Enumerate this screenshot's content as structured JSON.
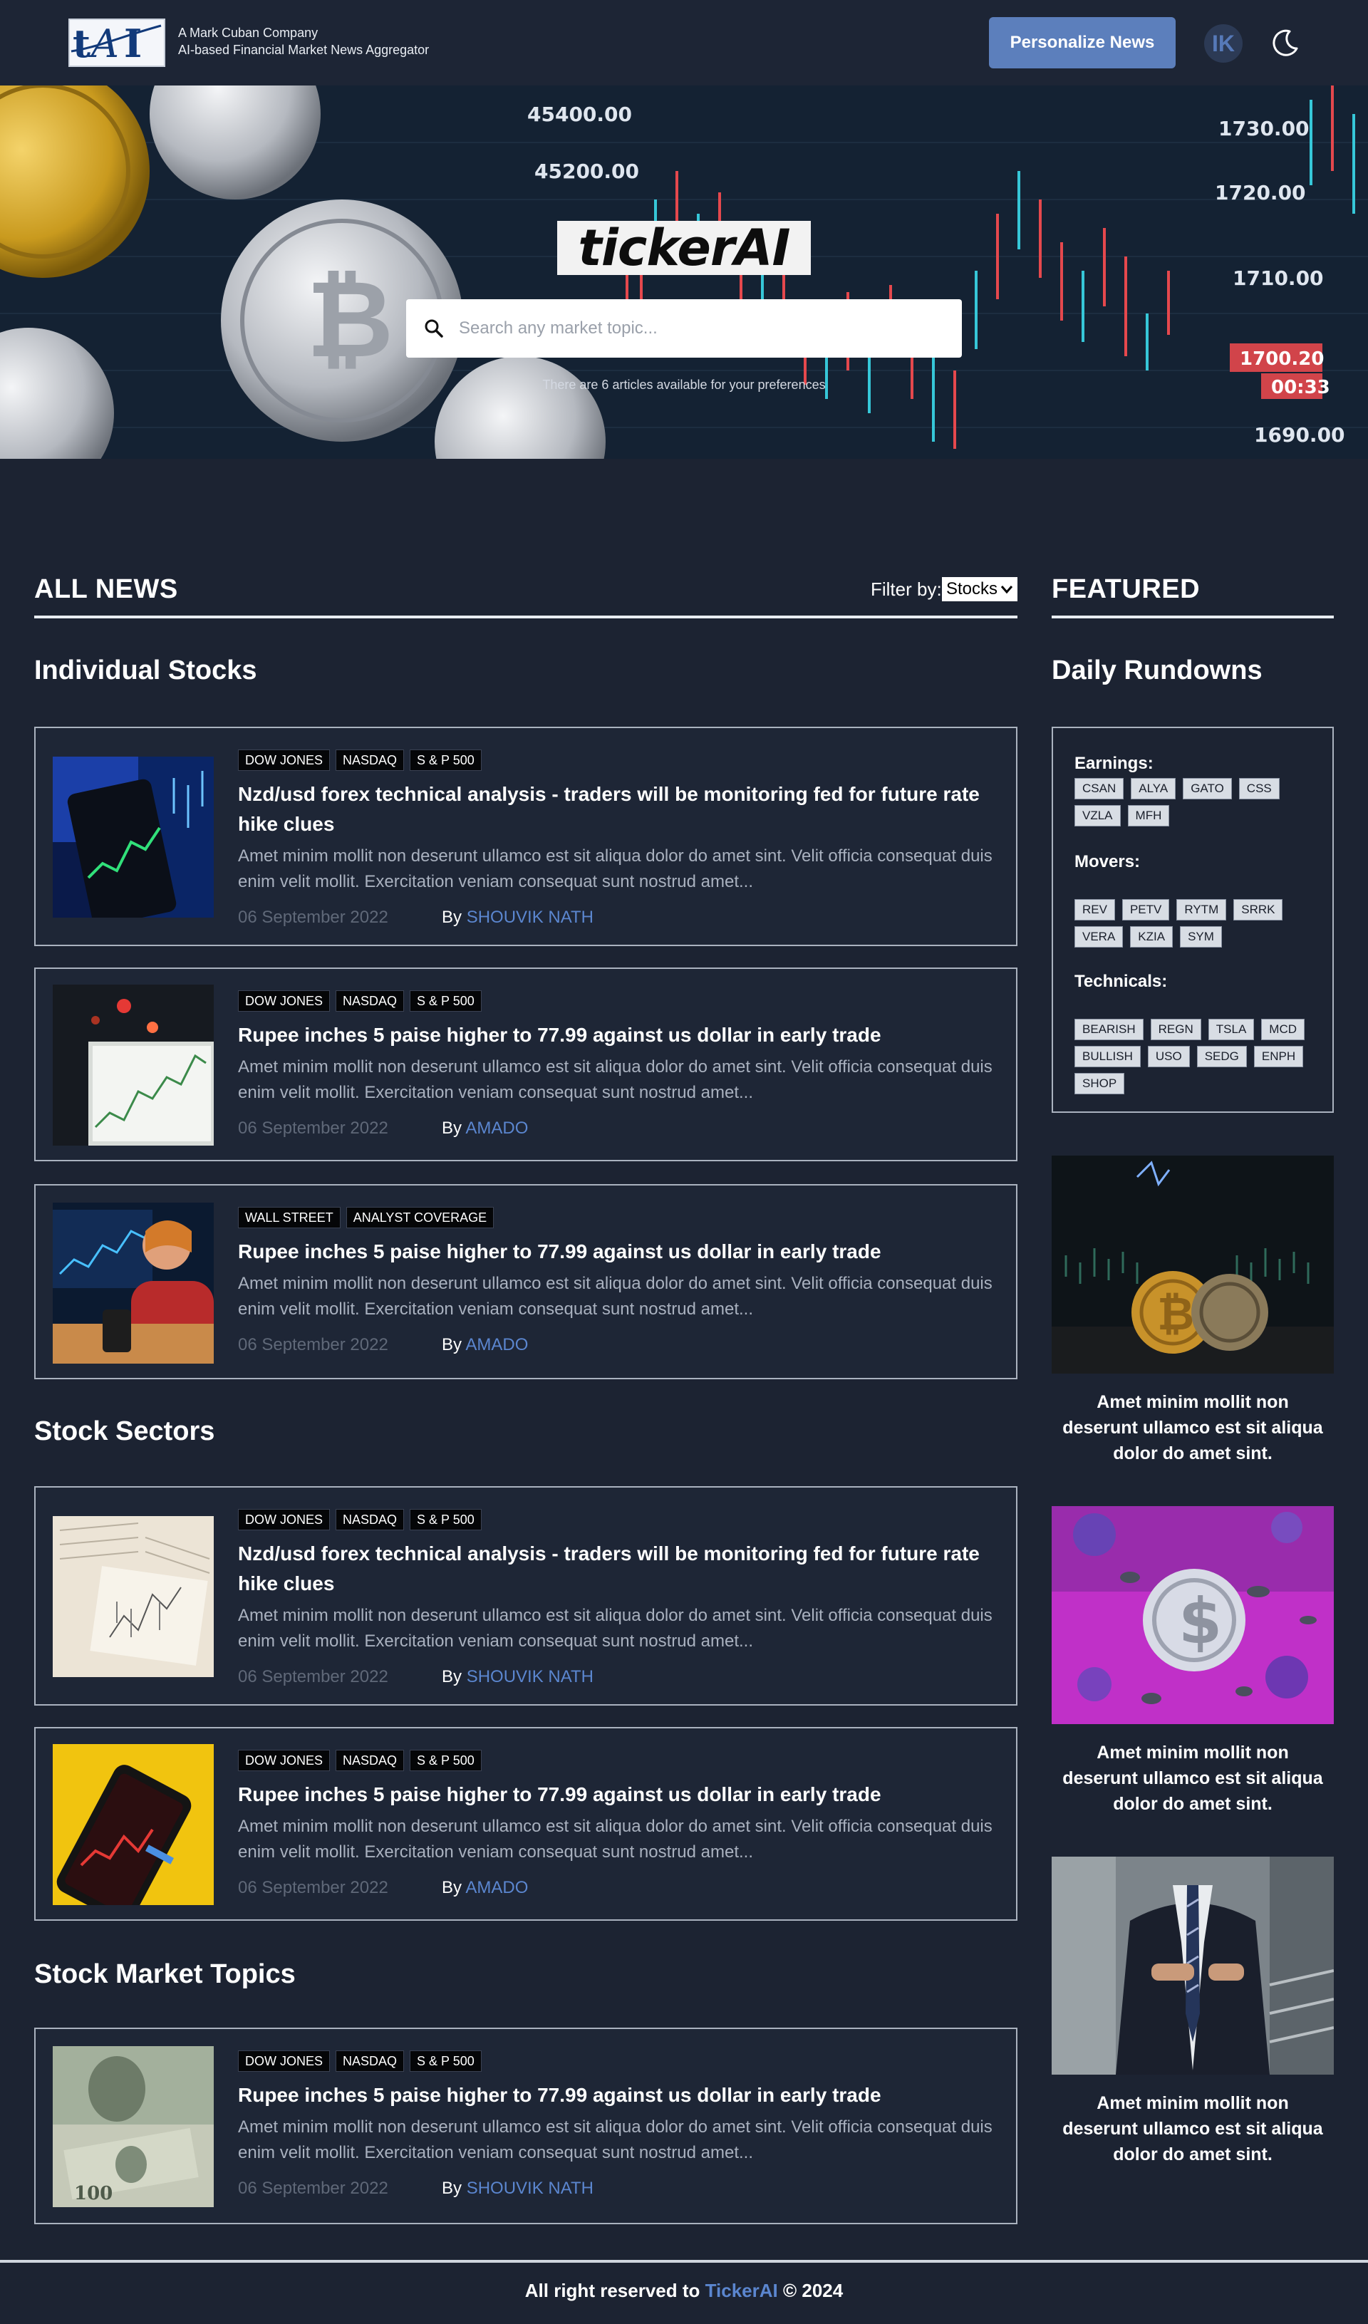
{
  "header": {
    "tagline_company": "A Mark Cuban Company",
    "tagline_desc": "AI-based Financial Market News Aggregator",
    "personalize_label": "Personalize News",
    "avatar_initials": "IK"
  },
  "hero": {
    "brand": "tickerAI",
    "search_placeholder": "Search any market topic...",
    "note": "There are 6 articles available for your preferences"
  },
  "main": {
    "all_news_label": "ALL NEWS",
    "filter_label": "Filter by:",
    "filter_value": "Stocks",
    "featured_label": "FEATURED",
    "sections": [
      {
        "title": "Individual Stocks"
      },
      {
        "title": "Stock Sectors"
      },
      {
        "title": "Stock Market Topics"
      }
    ],
    "articles": [
      {
        "tags": [
          "DOW JONES",
          "NASDAQ",
          "S & P 500"
        ],
        "title": "Nzd/usd forex technical analysis - traders will be monitoring fed for future rate hike clues",
        "excerpt": "Amet minim mollit non deserunt ullamco est sit aliqua dolor do amet sint. Velit officia consequat duis enim velit mollit. Exercitation veniam consequat sunt nostrud amet...",
        "date": "06 September 2022",
        "by": "By",
        "author": "SHOUVIK NATH"
      },
      {
        "tags": [
          "DOW JONES",
          "NASDAQ",
          "S & P 500"
        ],
        "title": "Rupee inches 5 paise higher to 77.99 against us dollar in early trade",
        "excerpt": "Amet minim mollit non deserunt ullamco est sit aliqua dolor do amet sint. Velit officia consequat duis enim velit mollit. Exercitation veniam consequat sunt nostrud amet...",
        "date": "06 September 2022",
        "by": "By",
        "author": "AMADO"
      },
      {
        "tags": [
          "WALL STREET",
          "ANALYST COVERAGE"
        ],
        "title": "Rupee inches 5 paise higher to 77.99 against us dollar in early trade",
        "excerpt": "Amet minim mollit non deserunt ullamco est sit aliqua dolor do amet sint. Velit officia consequat duis enim velit mollit. Exercitation veniam consequat sunt nostrud amet...",
        "date": "06 September 2022",
        "by": "By",
        "author": "AMADO"
      },
      {
        "tags": [
          "DOW JONES",
          "NASDAQ",
          "S & P 500"
        ],
        "title": "Nzd/usd forex technical analysis - traders will be monitoring fed for future rate hike clues",
        "excerpt": "Amet minim mollit non deserunt ullamco est sit aliqua dolor do amet sint. Velit officia consequat duis enim velit mollit. Exercitation veniam consequat sunt nostrud amet...",
        "date": "06 September 2022",
        "by": "By",
        "author": "SHOUVIK NATH"
      },
      {
        "tags": [
          "DOW JONES",
          "NASDAQ",
          "S & P 500"
        ],
        "title": "Rupee inches 5 paise higher to 77.99 against us dollar in early trade",
        "excerpt": "Amet minim mollit non deserunt ullamco est sit aliqua dolor do amet sint. Velit officia consequat duis enim velit mollit. Exercitation veniam consequat sunt nostrud amet...",
        "date": "06 September 2022",
        "by": "By",
        "author": "AMADO"
      },
      {
        "tags": [
          "DOW JONES",
          "NASDAQ",
          "S & P 500"
        ],
        "title": "Rupee inches 5 paise higher to 77.99 against us dollar in early trade",
        "excerpt": "Amet minim mollit non deserunt ullamco est sit aliqua dolor do amet sint. Velit officia consequat duis enim velit mollit. Exercitation veniam consequat sunt nostrud amet...",
        "date": "06 September 2022",
        "by": "By",
        "author": "SHOUVIK NATH"
      }
    ]
  },
  "sidebar": {
    "daily_rundowns_label": "Daily Rundowns",
    "earnings_label": "Earnings:",
    "earnings": [
      "CSAN",
      "ALYA",
      "GATO",
      "CSS",
      "VZLA",
      "MFH"
    ],
    "movers_label": "Movers:",
    "movers": [
      "REV",
      "PETV",
      "RYTM",
      "SRRK",
      "VERA",
      "KZIA",
      "SYM"
    ],
    "technicals_label": "Technicals:",
    "technicals": [
      "BEARISH",
      "REGN",
      "TSLA",
      "MCD",
      "BULLISH",
      "USO",
      "SEDG",
      "ENPH",
      "SHOP"
    ],
    "featured_captions": [
      "Amet minim mollit non deserunt ullamco est sit aliqua dolor do amet sint.",
      "Amet minim mollit non deserunt ullamco est sit aliqua dolor do amet sint.",
      "Amet minim mollit non deserunt ullamco est sit aliqua dolor do amet sint."
    ]
  },
  "footer": {
    "prefix": "All right reserved to",
    "brand": "TickerAI",
    "suffix": "© 2024"
  },
  "colors": {
    "background": "#1c2332",
    "accent": "#5c7fbc",
    "author_link": "#5b86cf"
  }
}
